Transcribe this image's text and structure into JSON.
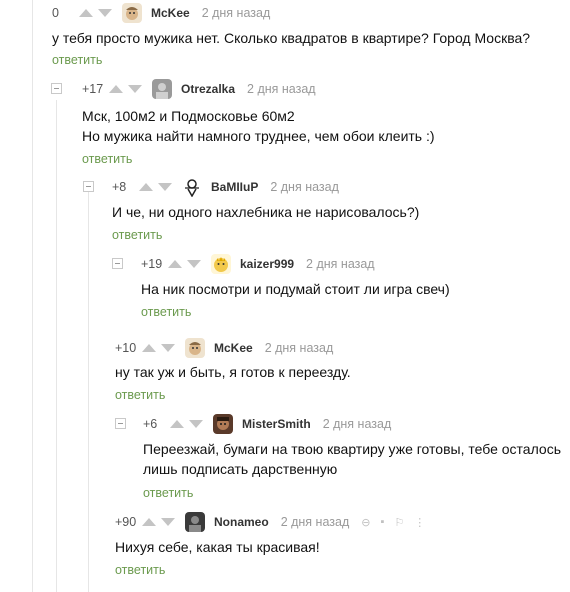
{
  "comments": [
    {
      "rating": "0",
      "author": "McKee",
      "time": "2 дня назад",
      "avatar": "mckee-avatar",
      "lines": [
        "у тебя просто мужика нет. Сколько квадратов в квартире? Город Москва?"
      ],
      "reply": "ответить"
    },
    {
      "rating": "+17",
      "author": "Otrezalka",
      "time": "2 дня назад",
      "avatar": "otrezalka-avatar",
      "lines": [
        "Мск, 100м2 и Подмосковье 60м2",
        "Но мужика найти намного труднее, чем обои клеить :)"
      ],
      "reply": "ответить"
    },
    {
      "rating": "+8",
      "author": "BaMIIuP",
      "time": "2 дня назад",
      "avatar": "vampire-avatar",
      "lines": [
        "И че, ни одного нахлебника не нарисовалось?)"
      ],
      "reply": "ответить"
    },
    {
      "rating": "+19",
      "author": "kaizer999",
      "time": "2 дня назад",
      "avatar": "kaizer-avatar",
      "lines": [
        "На ник посмотри и подумай стоит ли игра свеч)"
      ],
      "reply": "ответить"
    },
    {
      "rating": "+10",
      "author": "McKee",
      "time": "2 дня назад",
      "avatar": "mckee-avatar",
      "lines": [
        "ну так уж и быть, я готов к переезду."
      ],
      "reply": "ответить"
    },
    {
      "rating": "+6",
      "author": "MisterSmith",
      "time": "2 дня назад",
      "avatar": "mistersmith-avatar",
      "lines": [
        "Переезжай, бумаги на твою квартиру уже готовы, тебе осталось",
        "лишь подписать дарственную"
      ],
      "reply": "ответить"
    },
    {
      "rating": "+90",
      "author": "Nonameo",
      "time": "2 дня назад",
      "avatar": "nonameo-avatar",
      "lines": [
        "Нихуя себе, какая ты красивая!"
      ],
      "reply": "ответить"
    }
  ],
  "colors": {
    "reply_link": "#6b9a4e",
    "author": "#333333",
    "time": "#999999",
    "thread_line": "#e6e6e6"
  }
}
